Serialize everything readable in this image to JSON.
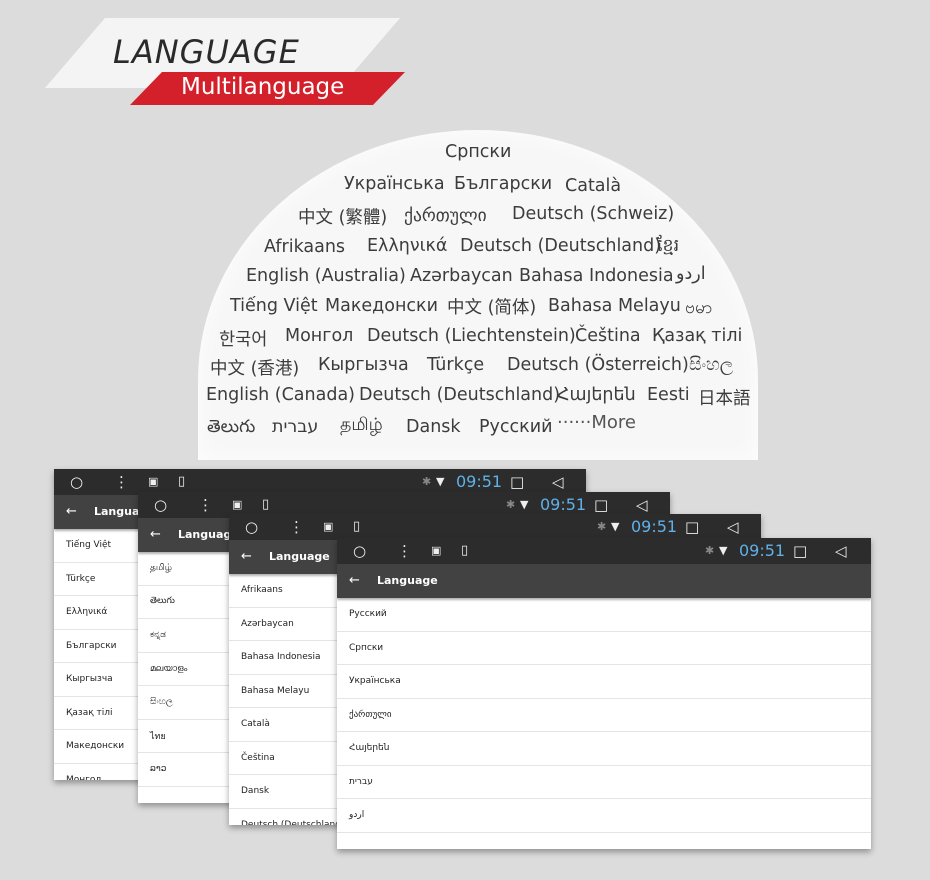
{
  "header": {
    "title": "LANGUAGE",
    "subtitle": "Multilanguage"
  },
  "bubble": {
    "languages": [
      "Српски",
      "Українська",
      "Български",
      "Català",
      "中文 (繁體)",
      "ქართული",
      "Deutsch (Schweiz)",
      "Afrikaans",
      "Ελληνικά",
      "Deutsch (Deutschland)",
      "ខ្មែរ",
      "English (Australia)",
      "Azərbaycan",
      "Bahasa Indonesia",
      "اردو",
      "Tiếng Việt",
      "Македонски",
      "中文 (简体)",
      "Bahasa Melayu",
      "ဗမာ",
      "한국어",
      "Монгол",
      "Deutsch (Liechtenstein)",
      "Čeština",
      "Қазақ тілі",
      "中文 (香港)",
      "Кыргызча",
      "Türkçe",
      "Deutsch (Österreich)",
      "සිංහල",
      "English (Canada)",
      "Deutsch (Deutschland)",
      "Հայերեն",
      "Eesti",
      "日本語",
      "తెలుగు",
      "עברית",
      "தமிழ்",
      "Dansk",
      "Русский"
    ],
    "more": "······More"
  },
  "screens": [
    {
      "time": "09:51",
      "title": "Language",
      "items": [
        "Tiếng Việt",
        "Türkçe",
        "Ελληνικά",
        "Български",
        "Кыргызча",
        "Қазақ тілі",
        "Македонски",
        "Монгол"
      ]
    },
    {
      "time": "09:51",
      "title": "Language",
      "items": [
        "தமிழ்",
        "తెలుగు",
        "ಕನ್ನಡ",
        "മലയാളം",
        "සිංහල",
        "ไทย",
        "ລາວ"
      ]
    },
    {
      "time": "09:51",
      "title": "Language",
      "items": [
        "Afrikaans",
        "Azərbaycan",
        "Bahasa Indonesia",
        "Bahasa Melayu",
        "Català",
        "Čeština",
        "Dansk",
        "Deutsch (Deutschland)"
      ]
    },
    {
      "time": "09:51",
      "title": "Language",
      "items": [
        "Русский",
        "Српски",
        "Українська",
        "ქართული",
        "Հայերեն",
        "עברית",
        "اردو"
      ]
    }
  ],
  "colors": {
    "accent_red": "#d3202a",
    "time_blue": "#5fb1e8",
    "toolbar": "#424242",
    "statusbar": "#2c2c2c"
  }
}
